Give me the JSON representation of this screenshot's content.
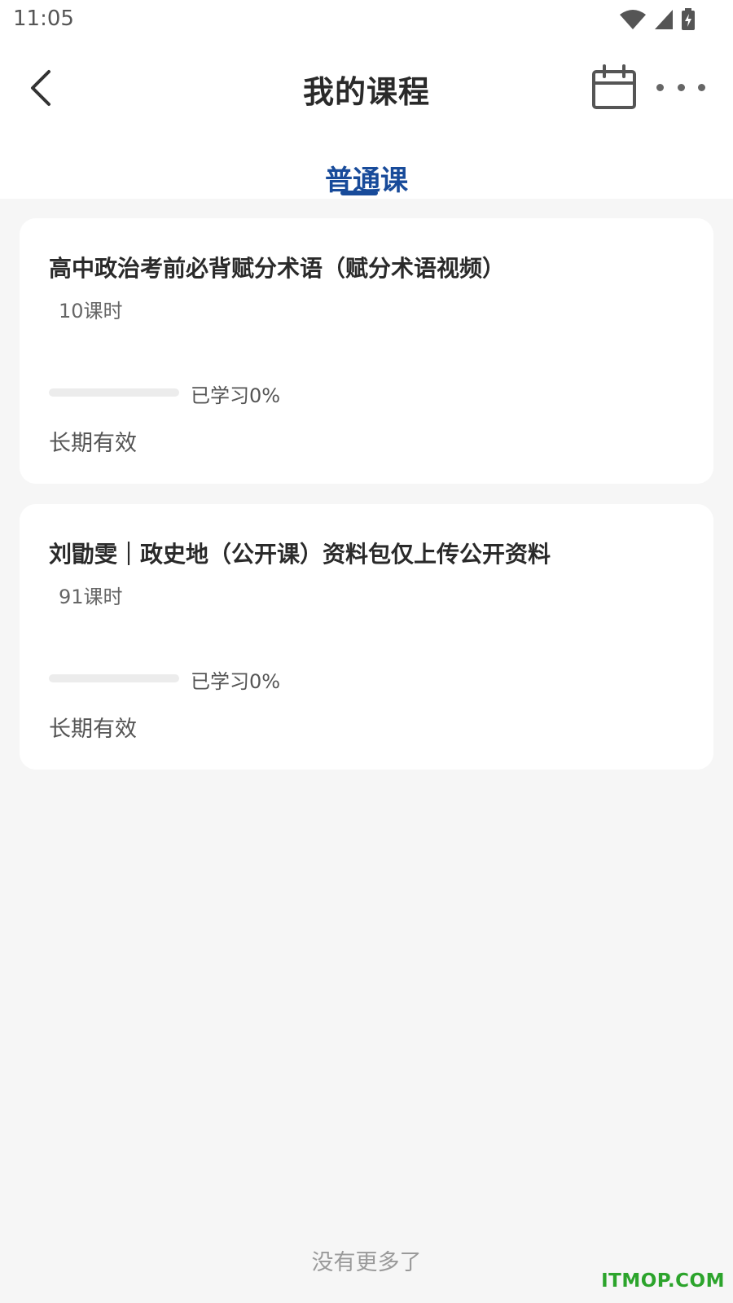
{
  "status_bar": {
    "time": "11:05",
    "icons": [
      "wifi-icon",
      "cell-signal-icon",
      "battery-charging-icon"
    ]
  },
  "header": {
    "title": "我的课程",
    "back_icon": "chevron-left-icon",
    "calendar_icon": "calendar-icon",
    "more_icon": "more-dots-icon"
  },
  "tabs": [
    {
      "label": "普通课",
      "active": true
    }
  ],
  "colors": {
    "accent": "#184b9a",
    "background": "#f6f6f6",
    "card": "#ffffff",
    "watermark": "#2ca42c"
  },
  "courses": [
    {
      "title": "高中政治考前必背赋分术语（赋分术语视频）",
      "lessons": "10课时",
      "progress_percent": 0,
      "progress_label": "已学习0%",
      "validity": "长期有效"
    },
    {
      "title": "刘勖雯｜政史地（公开课）资料包仅上传公开资料",
      "lessons": "91课时",
      "progress_percent": 0,
      "progress_label": "已学习0%",
      "validity": "长期有效"
    }
  ],
  "footer": {
    "no_more": "没有更多了"
  },
  "watermark": "ITMOP.COM"
}
